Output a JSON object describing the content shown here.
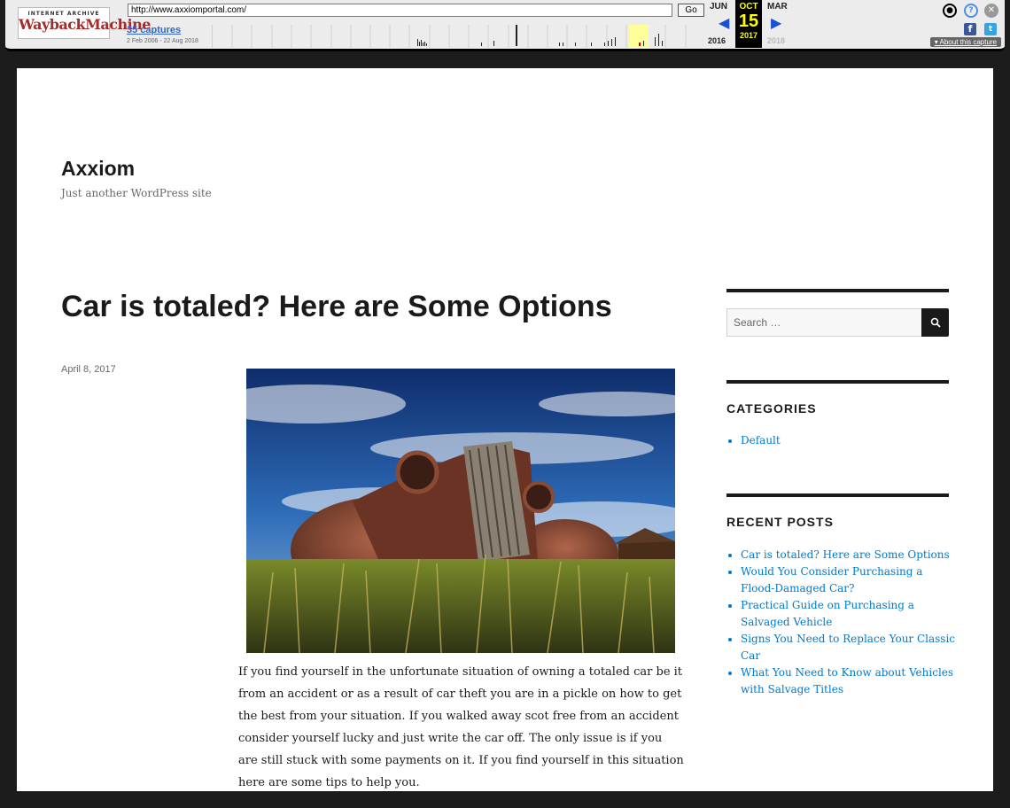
{
  "wayback": {
    "logo_top": "INTERNET ARCHIVE",
    "logo_main": "WaybackMachine",
    "url": "http://www.axxiomportal.com/",
    "go_label": "Go",
    "captures_label": "35 captures",
    "date_range": "2 Feb 2006 - 22 Aug 2018",
    "prev_month": "JUN",
    "current_month": "OCT",
    "next_month": "MAR",
    "current_day": "15",
    "prev_year": "2016",
    "current_year": "2017",
    "next_year": "2018",
    "about_label": "About this capture",
    "icons": [
      "user-icon",
      "help-icon",
      "close-icon",
      "facebook-icon",
      "twitter-icon"
    ],
    "highlight_color": "#ffff99"
  },
  "site": {
    "title": "Axxiom",
    "description": "Just another WordPress site"
  },
  "post": {
    "title": "Car is totaled? Here are Some Options",
    "date": "April 8, 2017",
    "image_desc": "rusted-classic-car-in-field",
    "body_lines": [
      "If you find yourself in the unfortunate situation of owning a totaled car be it",
      "from an accident or as a result of car theft you are in a pickle on how to get",
      "the best from your situation.  If you walked away scot free from an accident",
      "consider yourself lucky and just write the car off. The only issue is if you",
      "are still stuck with some payments on it. If you find yourself in this situation",
      "here are some tips to help you."
    ]
  },
  "sidebar": {
    "search_placeholder": "Search …",
    "categories_title": "CATEGORIES",
    "categories": [
      "Default"
    ],
    "recent_title": "RECENT POSTS",
    "recent_posts": [
      "Car is totaled? Here are Some Options",
      "Would You Consider Purchasing a Flood-Damaged Car?",
      "Practical Guide on Purchasing a Salvaged Vehicle",
      "Signs You Need to Replace Your Classic Car",
      "What You Need to Know about Vehicles with Salvage Titles"
    ],
    "link_color": "#007acc"
  }
}
